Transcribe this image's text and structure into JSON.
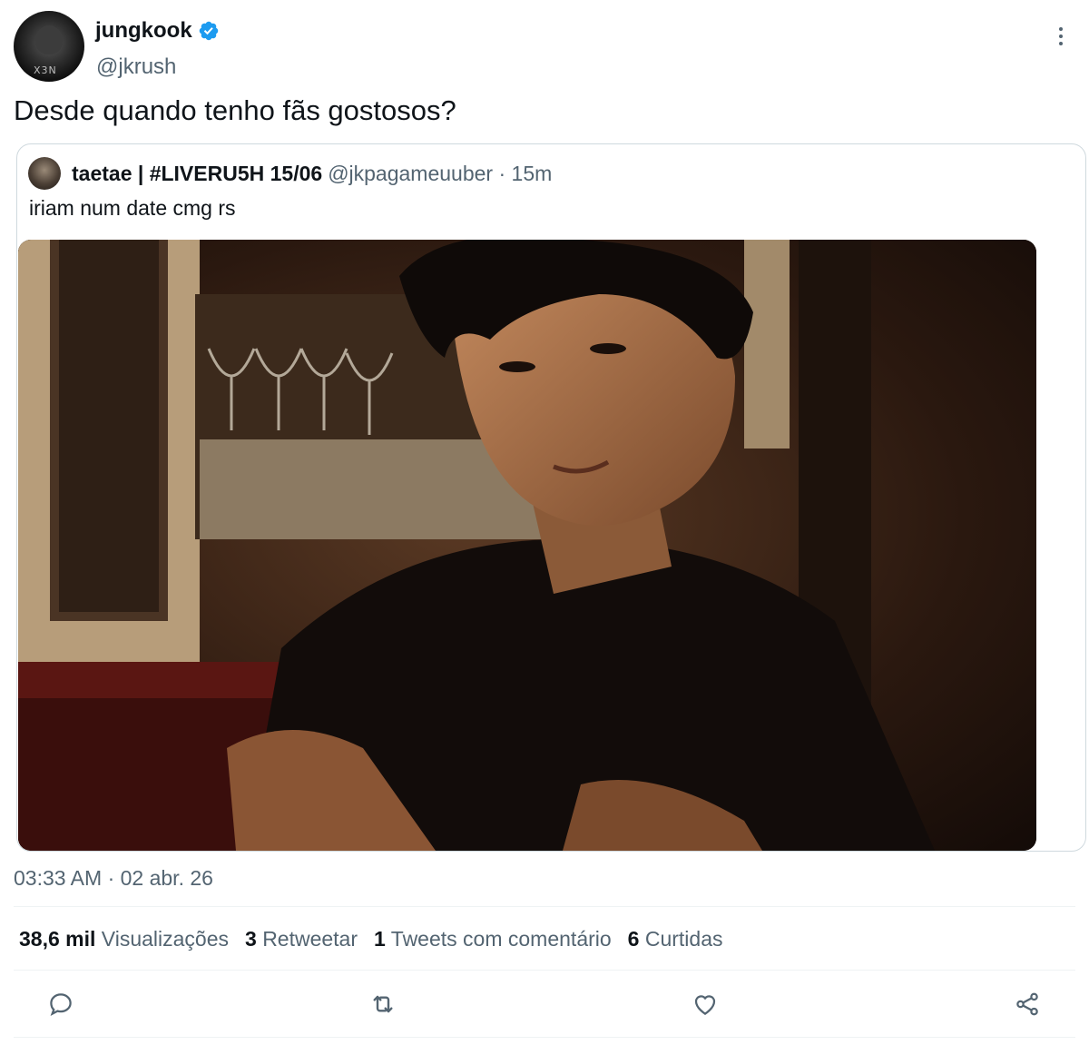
{
  "author": {
    "display_name": "jungkook",
    "handle": "@jkrush",
    "avatar_watermark": "X3N"
  },
  "tweet_text": "Desde quando tenho fãs gostosos?",
  "quoted": {
    "display_name": "taetae | #LIVERU5H 15/06",
    "handle": "@jkpagameuuber",
    "separator": "·",
    "time": "15m",
    "text": "iriam num date cmg rs"
  },
  "timestamp": "03:33 AM · 02 abr. 26",
  "stats": [
    {
      "count": "38,6 mil",
      "label": "Visualizações"
    },
    {
      "count": "3",
      "label": "Retweetar"
    },
    {
      "count": "1",
      "label": "Tweets com comentário"
    },
    {
      "count": "6",
      "label": "Curtidas"
    }
  ],
  "actions": [
    "reply-icon",
    "retweet-icon",
    "like-icon",
    "share-icon"
  ],
  "colors": {
    "verified": "#1d9bf0",
    "secondary_text": "#536471",
    "primary_text": "#0f1419",
    "border": "#cfd9de"
  }
}
